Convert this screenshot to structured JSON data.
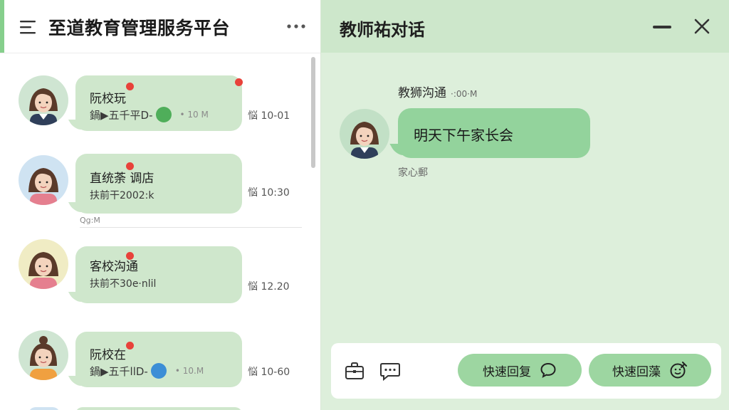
{
  "app": {
    "title": "至道教育管理服务平台"
  },
  "chat_list": [
    {
      "name": "阮校玩",
      "preview": "鍋▶五千平D-",
      "meta": "• 10 M",
      "time": "悩 10-01",
      "avatar_bg": "#cfe5d2"
    },
    {
      "name": "直统荼 调店",
      "preview": "扶前干2002:k",
      "meta": "",
      "time": "悩 10:30",
      "avatar_bg": "#cfe3f2"
    },
    {
      "name": "客校沟通",
      "preview": "扶前不30e·nlil",
      "meta": "",
      "time": "悩 12.20",
      "avatar_bg": "#f0ecc4"
    },
    {
      "name": "阮校在",
      "preview": "鍋▶五千llD-",
      "meta": "• 10.M",
      "time": "悩 10-60",
      "avatar_bg": "#cfe5d2"
    }
  ],
  "sub_meta": "Qg:M",
  "conversation": {
    "title": "教师祐对话",
    "sender": "教狮沟通",
    "sender_time": "·:00·M",
    "message": "明天下午家长会",
    "status": "家心郵"
  },
  "quick_replies": [
    {
      "label": "快速回复",
      "icon": "speech-bubble-icon"
    },
    {
      "label": "快速回藻",
      "icon": "emoji-icon"
    }
  ],
  "colors": {
    "accent": "#86cf8c",
    "bubble": "#cfe7cc",
    "msg_bubble": "#93d39c",
    "button": "#9dd6a1",
    "unread": "#e8423a"
  }
}
